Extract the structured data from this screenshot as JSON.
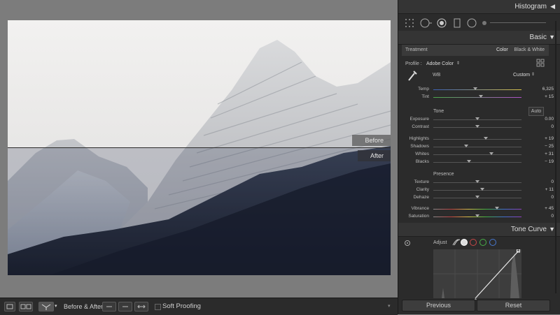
{
  "panel": {
    "histogram_title": "Histogram",
    "basic_title": "Basic",
    "treatment_label": "Treatment",
    "treatment_color": "Color",
    "treatment_bw": "Black & White",
    "profile_label": "Profile :",
    "profile_value": "Adobe Color",
    "wb_label": "WB",
    "wb_value": "Custom",
    "temp": {
      "label": "Temp",
      "value": "6,325",
      "level": 0.48
    },
    "tint": {
      "label": "Tint",
      "value": "+ 15",
      "level": 0.54
    },
    "tone_label": "Tone",
    "auto_label": "Auto",
    "exposure": {
      "label": "Exposure",
      "value": "0.00",
      "level": 0.5
    },
    "contrast": {
      "label": "Contrast",
      "value": "0",
      "level": 0.5
    },
    "highlights": {
      "label": "Highlights",
      "value": "+ 19",
      "level": 0.595
    },
    "shadows": {
      "label": "Shadows",
      "value": "− 25",
      "level": 0.375
    },
    "whites": {
      "label": "Whites",
      "value": "+ 31",
      "level": 0.655
    },
    "blacks": {
      "label": "Blacks",
      "value": "− 19",
      "level": 0.405
    },
    "presence_label": "Presence",
    "texture": {
      "label": "Texture",
      "value": "0",
      "level": 0.5
    },
    "clarity": {
      "label": "Clarity",
      "value": "+ 11",
      "level": 0.555
    },
    "dehaze": {
      "label": "Dehaze",
      "value": "0",
      "level": 0.5
    },
    "vibrance": {
      "label": "Vibrance",
      "value": "+ 45",
      "level": 0.725
    },
    "saturation": {
      "label": "Saturation",
      "value": "0",
      "level": 0.5
    },
    "tone_curve_title": "Tone Curve",
    "adjust_label": "Adjust",
    "previous_label": "Previous",
    "reset_label": "Reset"
  },
  "canvas": {
    "before_label": "Before",
    "after_label": "After"
  },
  "toolbar": {
    "before_after_label": "Before & After :",
    "soft_proofing_label": "Soft Proofing"
  },
  "colors": {
    "panel_bg": "#2b2b2b",
    "canvas_bg": "#7c7c7c",
    "accent_vibrance": "#7a4fd0"
  }
}
